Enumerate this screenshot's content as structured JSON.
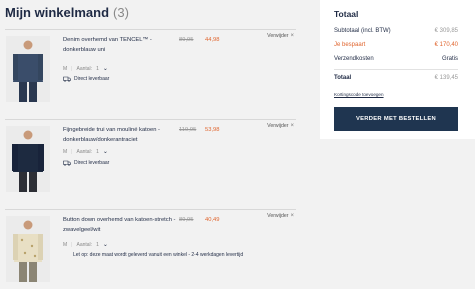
{
  "header": {
    "title": "Mijn winkelmand",
    "count": "(3)"
  },
  "items": [
    {
      "name": "Denim overhemd van TENCEL™ - donkerblauw uni",
      "old_price": "89,95",
      "new_price": "44,98",
      "remove_label": "Verwijder",
      "size": "M",
      "qty_label": "Aantal:",
      "qty": "1",
      "availability": "Direct leverbaar",
      "note": ""
    },
    {
      "name": "Fijngebreide trui van mouliné katoen - donkerblauw/donkerantraciet",
      "old_price": "119,95",
      "new_price": "53,98",
      "remove_label": "Verwijder",
      "size": "M",
      "qty_label": "Aantal:",
      "qty": "1",
      "availability": "Direct leverbaar",
      "note": ""
    },
    {
      "name": "Button down overhemd van katoen-stretch - zwavelgeel/wit",
      "old_price": "89,95",
      "new_price": "40,49",
      "remove_label": "Verwijder",
      "size": "M",
      "qty_label": "Aantal:",
      "qty": "1",
      "availability": "",
      "note": "Let op: deze maat wordt geleverd vanuit een winkel - 2-4 werkdagen levertijd"
    }
  ],
  "summary": {
    "title": "Totaal",
    "subtotal_label": "Subtotaal (incl. BTW)",
    "subtotal_value": "€ 309,85",
    "savings_label": "Je bespaart",
    "savings_value": "€ 170,40",
    "shipping_label": "Verzendkosten",
    "shipping_value": "Gratis",
    "total_label": "Totaal",
    "total_value": "€ 139,45",
    "coupon_label": "Kortingscode toevoegen",
    "cta_label": "VERDER MET BESTELLEN"
  },
  "colors": {
    "accent": "#e0652e",
    "brand": "#1f3550",
    "muted": "#999999"
  }
}
